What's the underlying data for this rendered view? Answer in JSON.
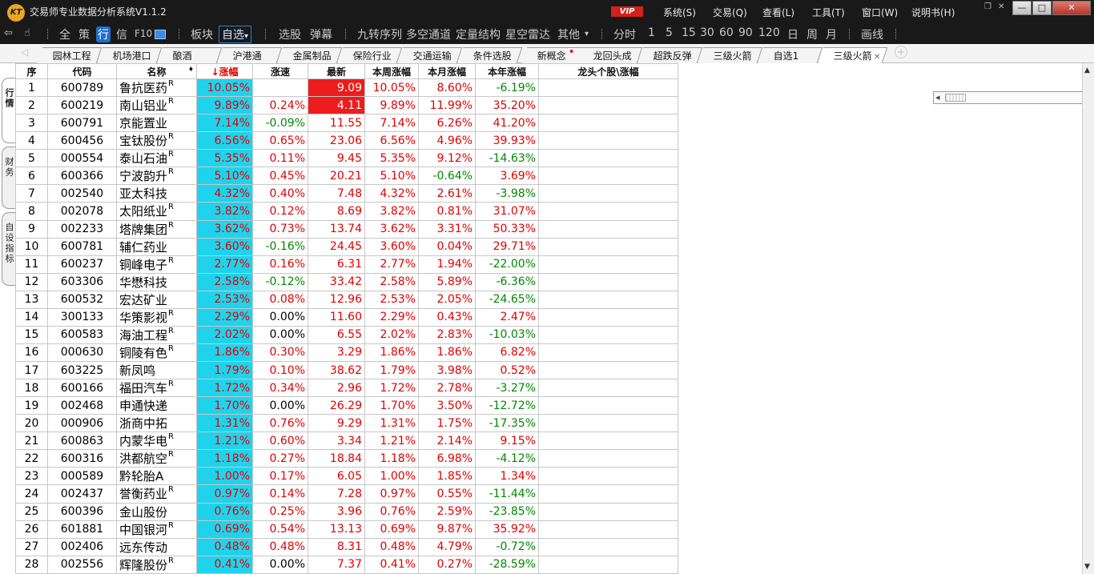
{
  "window": {
    "logo_text": "KT",
    "title": "交易师专业数据分析系统V1.1.2",
    "vip_badge": "VIP",
    "menus": [
      "系统(S)",
      "交易(Q)",
      "查看(L)",
      "工具(T)",
      "窗口(W)",
      "说明书(H)"
    ],
    "controls": {
      "restore": "❐",
      "close_small": "✕",
      "minimize": "—",
      "maximize": "□",
      "close": "✕"
    }
  },
  "toolbar": {
    "back_icon": "⇦",
    "hand_icon": "☝",
    "items": [
      "全",
      "策",
      "行",
      "信",
      "F10",
      "板块",
      "自选",
      "选股",
      "弹幕",
      "九转序列",
      "多空通道",
      "定量结构",
      "星空雷达",
      "其他",
      "分时",
      "1",
      "5",
      "15",
      "30",
      "60",
      "90",
      "120",
      "日",
      "周",
      "月",
      "画线"
    ],
    "selected_item": "行",
    "dropdown_item": "自选",
    "other_arrow": "▾"
  },
  "tabs": {
    "items": [
      "园林工程",
      "机场港口",
      "酿酒",
      "沪港通",
      "金属制品",
      "保险行业",
      "交通运输",
      "条件选股",
      "新概念",
      "龙回头成",
      "超跌反弹",
      "三级火箭",
      "自选1",
      "三级火箭"
    ],
    "active_index": 13,
    "dot_index": 8,
    "close_glyph": "✕",
    "add_glyph": "+",
    "scroll_left": "◂",
    "scroll_right": "▸",
    "nav_left": "◁"
  },
  "sidetabs": [
    {
      "label": "行情",
      "active": true
    },
    {
      "label": "财务",
      "active": false
    },
    {
      "label": "自设指标",
      "active": false
    }
  ],
  "table": {
    "headers": {
      "seq": "序",
      "code": "代码",
      "name": "名称",
      "name_sort": "♦",
      "pct": "涨幅",
      "pct_arrow": "↓",
      "speed": "涨速",
      "latest": "最新",
      "week": "本周涨幅",
      "month": "本月涨幅",
      "year": "本年涨幅",
      "leader": "龙头个股\\涨幅"
    },
    "rows": [
      {
        "seq": "1",
        "code": "600789",
        "name": "鲁抗医药",
        "r": "R",
        "pct": "10.05%",
        "speed": "",
        "speed_dir": "eq",
        "latest": "9.09",
        "latest_bg": true,
        "week": "10.05%",
        "month": "8.60%",
        "year": "-6.19%"
      },
      {
        "seq": "2",
        "code": "600219",
        "name": "南山铝业",
        "r": "R",
        "pct": "9.89%",
        "speed": "0.24%",
        "speed_dir": "up",
        "latest": "4.11",
        "latest_bg": true,
        "week": "9.89%",
        "month": "11.99%",
        "year": "35.20%"
      },
      {
        "seq": "3",
        "code": "600791",
        "name": "京能置业",
        "r": "",
        "pct": "7.14%",
        "speed": "-0.09%",
        "speed_dir": "dn",
        "latest": "11.55",
        "latest_bg": false,
        "week": "7.14%",
        "month": "6.26%",
        "year": "41.20%"
      },
      {
        "seq": "4",
        "code": "600456",
        "name": "宝钛股份",
        "r": "R",
        "pct": "6.56%",
        "speed": "0.65%",
        "speed_dir": "up",
        "latest": "23.06",
        "latest_bg": false,
        "week": "6.56%",
        "month": "4.96%",
        "year": "39.93%"
      },
      {
        "seq": "5",
        "code": "000554",
        "name": "泰山石油",
        "r": "R",
        "pct": "5.35%",
        "speed": "0.11%",
        "speed_dir": "up",
        "latest": "9.45",
        "latest_bg": false,
        "week": "5.35%",
        "month": "9.12%",
        "year": "-14.63%"
      },
      {
        "seq": "6",
        "code": "600366",
        "name": "宁波韵升",
        "r": "R",
        "pct": "5.10%",
        "speed": "0.45%",
        "speed_dir": "up",
        "latest": "20.21",
        "latest_bg": false,
        "week": "5.10%",
        "month": "-0.64%",
        "year": "3.69%"
      },
      {
        "seq": "7",
        "code": "002540",
        "name": "亚太科技",
        "r": "",
        "pct": "4.32%",
        "speed": "0.40%",
        "speed_dir": "up",
        "latest": "7.48",
        "latest_bg": false,
        "week": "4.32%",
        "month": "2.61%",
        "year": "-3.98%"
      },
      {
        "seq": "8",
        "code": "002078",
        "name": "太阳纸业",
        "r": "R",
        "pct": "3.82%",
        "speed": "0.12%",
        "speed_dir": "up",
        "latest": "8.69",
        "latest_bg": false,
        "week": "3.82%",
        "month": "0.81%",
        "year": "31.07%"
      },
      {
        "seq": "9",
        "code": "002233",
        "name": "塔牌集团",
        "r": "R",
        "pct": "3.62%",
        "speed": "0.73%",
        "speed_dir": "up",
        "latest": "13.74",
        "latest_bg": false,
        "week": "3.62%",
        "month": "3.31%",
        "year": "50.33%"
      },
      {
        "seq": "10",
        "code": "600781",
        "name": "辅仁药业",
        "r": "",
        "pct": "3.60%",
        "speed": "-0.16%",
        "speed_dir": "dn",
        "latest": "24.45",
        "latest_bg": false,
        "week": "3.60%",
        "month": "0.04%",
        "year": "29.71%"
      },
      {
        "seq": "11",
        "code": "600237",
        "name": "铜峰电子",
        "r": "R",
        "pct": "2.77%",
        "speed": "0.16%",
        "speed_dir": "up",
        "latest": "6.31",
        "latest_bg": false,
        "week": "2.77%",
        "month": "1.94%",
        "year": "-22.00%"
      },
      {
        "seq": "12",
        "code": "603306",
        "name": "华懋科技",
        "r": "",
        "pct": "2.58%",
        "speed": "-0.12%",
        "speed_dir": "dn",
        "latest": "33.42",
        "latest_bg": false,
        "week": "2.58%",
        "month": "5.89%",
        "year": "-6.36%"
      },
      {
        "seq": "13",
        "code": "600532",
        "name": "宏达矿业",
        "r": "",
        "pct": "2.53%",
        "speed": "0.08%",
        "speed_dir": "up",
        "latest": "12.96",
        "latest_bg": false,
        "week": "2.53%",
        "month": "2.05%",
        "year": "-24.65%"
      },
      {
        "seq": "14",
        "code": "300133",
        "name": "华策影视",
        "r": "R",
        "pct": "2.29%",
        "speed": "0.00%",
        "speed_dir": "eq",
        "latest": "11.60",
        "latest_bg": false,
        "week": "2.29%",
        "month": "0.43%",
        "year": "2.47%"
      },
      {
        "seq": "15",
        "code": "600583",
        "name": "海油工程",
        "r": "R",
        "pct": "2.02%",
        "speed": "0.00%",
        "speed_dir": "eq",
        "latest": "6.55",
        "latest_bg": false,
        "week": "2.02%",
        "month": "2.83%",
        "year": "-10.03%"
      },
      {
        "seq": "16",
        "code": "000630",
        "name": "铜陵有色",
        "r": "R",
        "pct": "1.86%",
        "speed": "0.30%",
        "speed_dir": "up",
        "latest": "3.29",
        "latest_bg": false,
        "week": "1.86%",
        "month": "1.86%",
        "year": "6.82%"
      },
      {
        "seq": "17",
        "code": "603225",
        "name": "新凤鸣",
        "r": "",
        "pct": "1.79%",
        "speed": "0.10%",
        "speed_dir": "up",
        "latest": "38.62",
        "latest_bg": false,
        "week": "1.79%",
        "month": "3.98%",
        "year": "0.52%"
      },
      {
        "seq": "18",
        "code": "600166",
        "name": "福田汽车",
        "r": "R",
        "pct": "1.72%",
        "speed": "0.34%",
        "speed_dir": "up",
        "latest": "2.96",
        "latest_bg": false,
        "week": "1.72%",
        "month": "2.78%",
        "year": "-3.27%"
      },
      {
        "seq": "19",
        "code": "002468",
        "name": "申通快递",
        "r": "",
        "pct": "1.70%",
        "speed": "0.00%",
        "speed_dir": "eq",
        "latest": "26.29",
        "latest_bg": false,
        "week": "1.70%",
        "month": "3.50%",
        "year": "-12.72%"
      },
      {
        "seq": "20",
        "code": "000906",
        "name": "浙商中拓",
        "r": "",
        "pct": "1.31%",
        "speed": "0.76%",
        "speed_dir": "up",
        "latest": "9.29",
        "latest_bg": false,
        "week": "1.31%",
        "month": "1.75%",
        "year": "-17.35%"
      },
      {
        "seq": "21",
        "code": "600863",
        "name": "内蒙华电",
        "r": "R",
        "pct": "1.21%",
        "speed": "0.60%",
        "speed_dir": "up",
        "latest": "3.34",
        "latest_bg": false,
        "week": "1.21%",
        "month": "2.14%",
        "year": "9.15%"
      },
      {
        "seq": "22",
        "code": "600316",
        "name": "洪都航空",
        "r": "R",
        "pct": "1.18%",
        "speed": "0.27%",
        "speed_dir": "up",
        "latest": "18.84",
        "latest_bg": false,
        "week": "1.18%",
        "month": "6.98%",
        "year": "-4.12%"
      },
      {
        "seq": "23",
        "code": "000589",
        "name": "黔轮胎A",
        "r": "",
        "pct": "1.00%",
        "speed": "0.17%",
        "speed_dir": "up",
        "latest": "6.05",
        "latest_bg": false,
        "week": "1.00%",
        "month": "1.85%",
        "year": "1.34%"
      },
      {
        "seq": "24",
        "code": "002437",
        "name": "誉衡药业",
        "r": "R",
        "pct": "0.97%",
        "speed": "0.14%",
        "speed_dir": "up",
        "latest": "7.28",
        "latest_bg": false,
        "week": "0.97%",
        "month": "0.55%",
        "year": "-11.44%"
      },
      {
        "seq": "25",
        "code": "600396",
        "name": "金山股份",
        "r": "",
        "pct": "0.76%",
        "speed": "0.25%",
        "speed_dir": "up",
        "latest": "3.96",
        "latest_bg": false,
        "week": "0.76%",
        "month": "2.59%",
        "year": "-23.85%"
      },
      {
        "seq": "26",
        "code": "601881",
        "name": "中国银河",
        "r": "R",
        "pct": "0.69%",
        "speed": "0.54%",
        "speed_dir": "up",
        "latest": "13.13",
        "latest_bg": false,
        "week": "0.69%",
        "month": "9.87%",
        "year": "35.92%"
      },
      {
        "seq": "27",
        "code": "002406",
        "name": "远东传动",
        "r": "",
        "pct": "0.48%",
        "speed": "0.48%",
        "speed_dir": "up",
        "latest": "8.31",
        "latest_bg": false,
        "week": "0.48%",
        "month": "4.79%",
        "year": "-0.72%"
      },
      {
        "seq": "28",
        "code": "002556",
        "name": "辉隆股份",
        "r": "R",
        "pct": "0.41%",
        "speed": "0.00%",
        "speed_dir": "eq",
        "latest": "7.37",
        "latest_bg": false,
        "week": "0.41%",
        "month": "0.27%",
        "year": "-28.59%"
      }
    ]
  },
  "colors": {
    "up": "#e00000",
    "down": "#008800",
    "pct_highlight": "#1fd3ec",
    "latest_highlight": "#ee1c1c"
  },
  "scroll": {
    "up": "▲",
    "down": "▼"
  }
}
